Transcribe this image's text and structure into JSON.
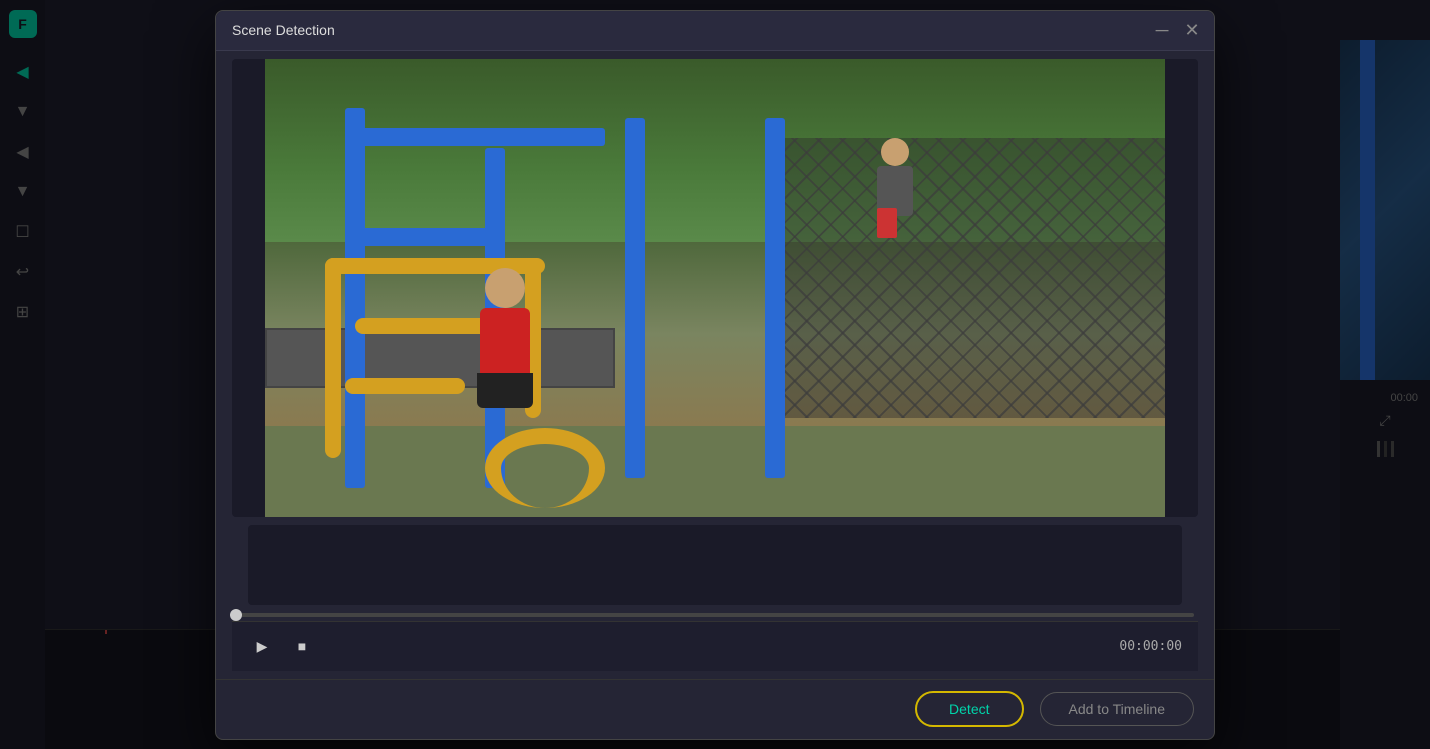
{
  "app": {
    "title": "Scene Detection",
    "logo": "F"
  },
  "dialog": {
    "title": "Scene Detection",
    "close_label": "×"
  },
  "controls": {
    "play_label": "▶",
    "stop_label": "■",
    "time": "00:00:00"
  },
  "buttons": {
    "detect": "Detect",
    "add_to_timeline": "Add to Timeline"
  },
  "sidebar": {
    "icons": [
      "◀",
      "▼",
      "◀",
      "▼",
      "☐",
      "↩",
      "⊞"
    ]
  },
  "colors": {
    "accent": "#00d4aa",
    "detect_border": "#d4b800",
    "bg_dark": "#1a1a28",
    "bg_dialog": "#252535"
  }
}
